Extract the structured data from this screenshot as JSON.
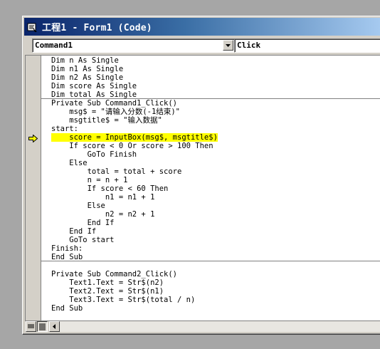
{
  "window": {
    "title": "工程1 - Form1 (Code)",
    "icon": "code-window-icon"
  },
  "object_combo": {
    "value": "Command1"
  },
  "procedure_combo": {
    "value": "Click"
  },
  "code_lines": [
    "Dim n As Single",
    "Dim n1 As Single",
    "Dim n2 As Single",
    "Dim score As Single",
    "Dim total As Single",
    "Private Sub Command1_Click()",
    "    msg$ = \"请输入分数(-1结束)\"",
    "    msgtitle$ = \"输入数据\"",
    "start:",
    "    score = InputBox(msg$, msgtitle$)",
    "    If score < 0 Or score > 100 Then",
    "        GoTo Finish",
    "    Else",
    "        total = total + score",
    "        n = n + 1",
    "        If score < 60 Then",
    "            n1 = n1 + 1",
    "        Else",
    "            n2 = n2 + 1",
    "        End If",
    "    End If",
    "    GoTo start",
    "Finish:",
    "End Sub",
    "",
    "Private Sub Command2_Click()",
    "    Text1.Text = Str$(n2)",
    "    Text2.Text = Str$(n1)",
    "    Text3.Text = Str$(total / n)",
    "End Sub"
  ],
  "current_line_index": 9,
  "colors": {
    "highlight": "#ffff00",
    "execution_arrow": "#ffff00"
  },
  "icons": {
    "execution_pointer": "execution-arrow-icon",
    "procedure_view": "procedure-view-icon",
    "full_module_view": "full-module-view-icon",
    "scroll_left": "scroll-left-arrow-icon",
    "dropdown": "chevron-down-icon"
  }
}
